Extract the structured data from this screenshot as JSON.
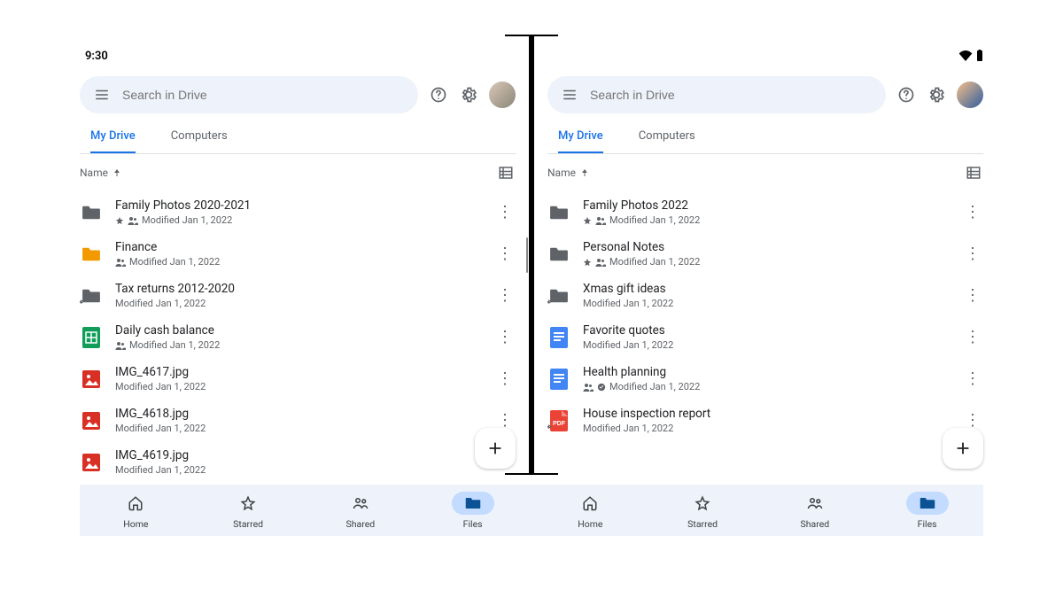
{
  "status": {
    "time": "9:30"
  },
  "search": {
    "placeholder": "Search in Drive"
  },
  "tabs": {
    "my_drive": "My Drive",
    "computers": "Computers"
  },
  "sort": {
    "label": "Name"
  },
  "nav": {
    "home": "Home",
    "starred": "Starred",
    "shared": "Shared",
    "files": "Files"
  },
  "modified_default": "Modified Jan 1, 2022",
  "left": {
    "files": [
      {
        "name": "Family Photos 2020-2021",
        "meta": "Modified Jan 1, 2022",
        "icon": "folder-gray",
        "starred": true,
        "shared": true
      },
      {
        "name": "Finance",
        "meta": "Modified Jan 1, 2022",
        "icon": "folder-orange",
        "shared": true
      },
      {
        "name": "Tax returns 2012-2020",
        "meta": "Modified Jan 1, 2022",
        "icon": "folder-gray",
        "shortcut": true
      },
      {
        "name": "Daily cash balance",
        "meta": "Modified Jan 1, 2022",
        "icon": "sheets",
        "shared": true
      },
      {
        "name": "IMG_4617.jpg",
        "meta": "Modified Jan 1, 2022",
        "icon": "image"
      },
      {
        "name": "IMG_4618.jpg",
        "meta": "Modified Jan 1, 2022",
        "icon": "image"
      },
      {
        "name": "IMG_4619.jpg",
        "meta": "Modified Jan 1, 2022",
        "icon": "image"
      }
    ]
  },
  "right": {
    "files": [
      {
        "name": "Family Photos 2022",
        "meta": "Modified Jan 1, 2022",
        "icon": "folder-gray",
        "starred": true,
        "shared": true
      },
      {
        "name": "Personal Notes",
        "meta": "Modified Jan 1, 2022",
        "icon": "folder-gray",
        "starred": true,
        "shared": true
      },
      {
        "name": "Xmas gift ideas",
        "meta": "Modified Jan 1, 2022",
        "icon": "folder-gray",
        "shortcut": true
      },
      {
        "name": "Favorite quotes",
        "meta": "Modified Jan 1, 2022",
        "icon": "docs"
      },
      {
        "name": "Health planning",
        "meta": "Modified Jan 1, 2022",
        "icon": "docs",
        "shared": true,
        "offline": true
      },
      {
        "name": "House inspection report",
        "meta": "Modified Jan 1, 2022",
        "icon": "pdf",
        "shortcut": true
      }
    ]
  }
}
